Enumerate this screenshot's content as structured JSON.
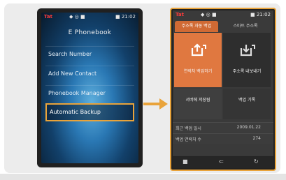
{
  "colors": {
    "highlight": "#e9a33a",
    "accent_orange": "#e07840"
  },
  "left_phone": {
    "status": {
      "left": "Tat",
      "middle": "◆ ◎ ■",
      "clock": "■ 21:02"
    },
    "title": "E Phonebook",
    "menu": [
      "Search Number",
      "Add New Contact",
      "Phonebook Manager",
      "Automatic Backup"
    ],
    "selected_index": 3
  },
  "right_phone": {
    "status": {
      "left": "Tat",
      "middle": "◆ ◎ ■",
      "clock": "■ 21:02"
    },
    "tabs": [
      "주소록 자동 백업",
      "스마트 주소록"
    ],
    "tiles": {
      "big_orange": "연락처 백업하기",
      "big_gray": "주소록 내보내기",
      "small_a": "서버에 저장됨",
      "small_b": "백업 기록"
    },
    "info": [
      {
        "key": "최근 백업 일시",
        "value": "2009.01.22"
      },
      {
        "key": "백업 연락처 수",
        "value": "274"
      }
    ],
    "bottom_icons": [
      "menu-icon",
      "back-icon",
      "refresh-icon"
    ]
  }
}
